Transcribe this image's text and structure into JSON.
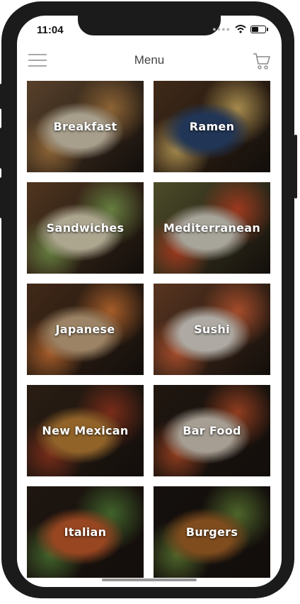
{
  "status": {
    "time": "11:04"
  },
  "navbar": {
    "title": "Menu"
  },
  "categories": [
    {
      "label": "Breakfast",
      "icon": "breakfast-photo",
      "colors": [
        "#7a5a3c",
        "#e9dcc2",
        "#c28a4a"
      ]
    },
    {
      "label": "Ramen",
      "icon": "ramen-photo",
      "colors": [
        "#5a3b23",
        "#2f4b79",
        "#e6c06b"
      ]
    },
    {
      "label": "Sandwiches",
      "icon": "sandwiches-photo",
      "colors": [
        "#6e4a2c",
        "#efe6c7",
        "#8fb05a"
      ]
    },
    {
      "label": "Mediterranean",
      "icon": "mediterranean-photo",
      "colors": [
        "#6b6a3a",
        "#e8e3d6",
        "#d94f2b"
      ]
    },
    {
      "label": "Japanese",
      "icon": "japanese-photo",
      "colors": [
        "#5b3a22",
        "#d9b68c",
        "#e6813a"
      ]
    },
    {
      "label": "Sushi",
      "icon": "sushi-photo",
      "colors": [
        "#7b4a2d",
        "#f2ece2",
        "#e46a3c"
      ]
    },
    {
      "label": "New Mexican",
      "icon": "new-mexican-photo",
      "colors": [
        "#3b2a1c",
        "#c98a3a",
        "#a83e24"
      ]
    },
    {
      "label": "Bar Food",
      "icon": "bar-food-photo",
      "colors": [
        "#2c2017",
        "#e7dccc",
        "#c8552c"
      ]
    },
    {
      "label": "Italian",
      "icon": "italian-photo",
      "colors": [
        "#2b1f17",
        "#d2622e",
        "#5b8a3c"
      ]
    },
    {
      "label": "Burgers",
      "icon": "burgers-photo",
      "colors": [
        "#1e1712",
        "#b06a2a",
        "#6c8d3b"
      ]
    }
  ]
}
